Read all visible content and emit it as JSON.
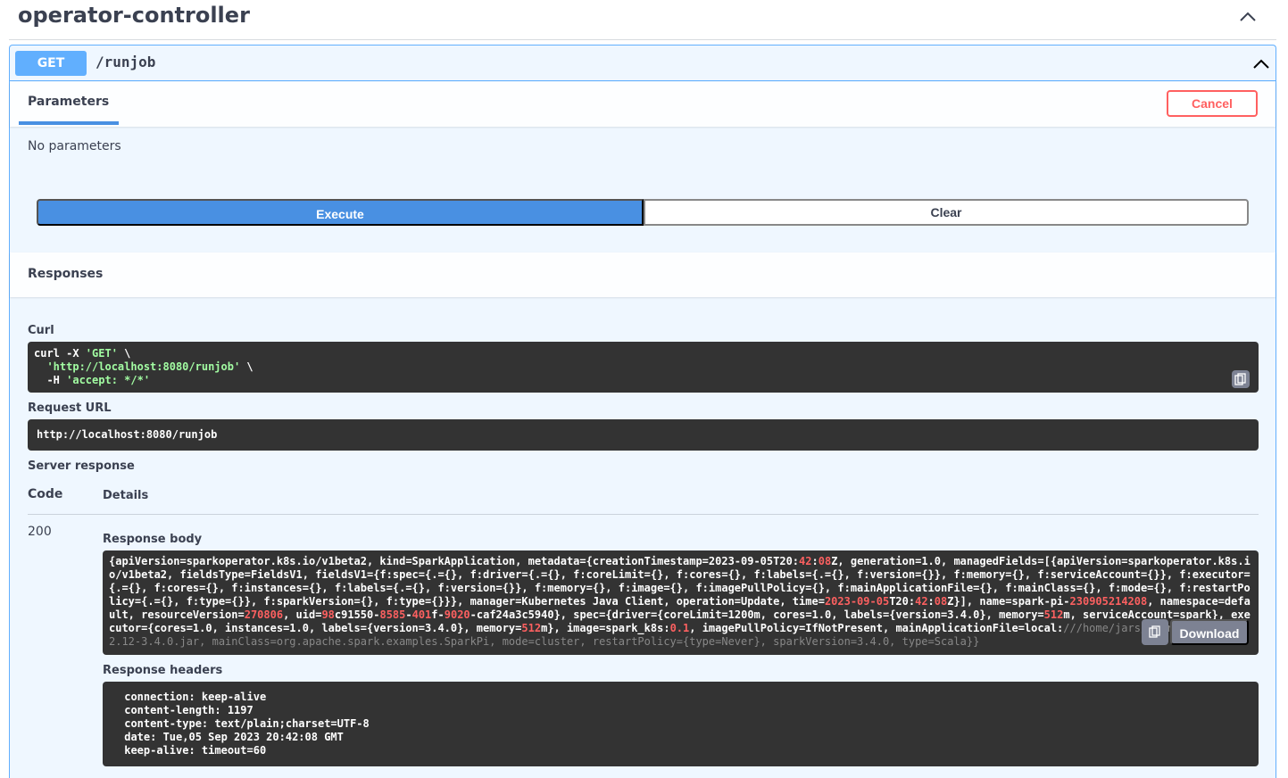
{
  "tag": {
    "title": "operator-controller"
  },
  "operation": {
    "method": "GET",
    "path": "/runjob"
  },
  "parameters": {
    "tab_label": "Parameters",
    "cancel_label": "Cancel",
    "empty_text": "No parameters"
  },
  "actions": {
    "execute_label": "Execute",
    "clear_label": "Clear"
  },
  "responses": {
    "title": "Responses",
    "curl_label": "Curl",
    "curl": {
      "line1": "curl -X ",
      "line1_method": "'GET'",
      "line1_end": " \\",
      "line2_indent": "  ",
      "line2_url": "'http://localhost:8080/runjob'",
      "line2_end": " \\",
      "line3_start": "  -H ",
      "line3_header": "'accept: */*'"
    },
    "request_url_label": "Request URL",
    "request_url": "http://localhost:8080/runjob",
    "server_response_label": "Server response",
    "col_code": "Code",
    "col_details": "Details",
    "status_code": "200",
    "response_body_label": "Response body",
    "response_body_segments": [
      {
        "t": "{apiVersion=sparkoperator.k8s.io/v1beta2, kind=SparkApplication, metadata={creationTimestamp=2023-09-05T20:",
        "c": ""
      },
      {
        "t": "42",
        "c": "num"
      },
      {
        "t": ":",
        "c": ""
      },
      {
        "t": "08",
        "c": "num"
      },
      {
        "t": "Z, generation=1.0, managedFields=[{apiVersion=sparkoperator.k8s.io/v1beta2, fieldsType=FieldsV1, fieldsV1={f:spec={.={}, f:driver={.={}, f:coreLimit={}, f:cores={}, f:labels={.={}, f:version={}}, f:memory={}, f:serviceAccount={}}, f:executor={.={}, f:cores={}, f:instances={}, f:labels={.={}, f:version={}}, f:memory={}, f:image={}, f:imagePullPolicy={}, f:mainApplicationFile={}, f:mainClass={}, f:mode={}, f:restartPolicy={.={}, f:type={}}, f:sparkVersion={}, f:type={}}}, manager=Kubernetes Java Client, operation=Update, time=",
        "c": ""
      },
      {
        "t": "2023-09-05",
        "c": "num"
      },
      {
        "t": "T20:",
        "c": ""
      },
      {
        "t": "42",
        "c": "num"
      },
      {
        "t": ":",
        "c": ""
      },
      {
        "t": "08",
        "c": "num"
      },
      {
        "t": "Z}], name=spark-pi-",
        "c": ""
      },
      {
        "t": "230905214208",
        "c": "num"
      },
      {
        "t": ", namespace=default, resourceVersion=",
        "c": ""
      },
      {
        "t": "270806",
        "c": "num"
      },
      {
        "t": ", uid=",
        "c": ""
      },
      {
        "t": "98",
        "c": "num"
      },
      {
        "t": "c91550-",
        "c": ""
      },
      {
        "t": "8585",
        "c": "num"
      },
      {
        "t": "-",
        "c": ""
      },
      {
        "t": "401",
        "c": "num"
      },
      {
        "t": "f-",
        "c": ""
      },
      {
        "t": "9020",
        "c": "num"
      },
      {
        "t": "-caf24a3c5940}, spec={driver={coreLimit=1200m, cores=1.0, labels={version=3.4.0}, memory=",
        "c": ""
      },
      {
        "t": "512",
        "c": "num"
      },
      {
        "t": "m, serviceAccount=spark}, executor={cores=1.0, instances=1.0, labels={version=3.4.0}, memory=",
        "c": ""
      },
      {
        "t": "512",
        "c": "num"
      },
      {
        "t": "m}, image=spark_k8s:",
        "c": ""
      },
      {
        "t": "0.1",
        "c": "num"
      },
      {
        "t": ", imagePullPolicy=IfNotPresent, mainApplicationFile=local:",
        "c": ""
      },
      {
        "t": "///home/jars/spark-examples_2.12-3.4.0.jar, mainClass=org.apache.spark.examples.SparkPi, mode=cluster, restartPolicy={type=Never}, sparkVersion=3.4.0, type=Scala}}",
        "c": "dim"
      }
    ],
    "download_label": "Download",
    "response_headers_label": "Response headers",
    "response_headers": " connection: keep-alive \n content-length: 1197 \n content-type: text/plain;charset=UTF-8 \n date: Tue,05 Sep 2023 20:42:08 GMT \n keep-alive: timeout=60 "
  },
  "icons": [
    "chevron-up-icon",
    "copy-icon"
  ],
  "colors": {
    "get_accent": "#61affe",
    "execute": "#4990e2",
    "cancel": "#ff6060",
    "code_bg": "#333333",
    "string": "#a2fca2",
    "number": "#fc6060"
  }
}
